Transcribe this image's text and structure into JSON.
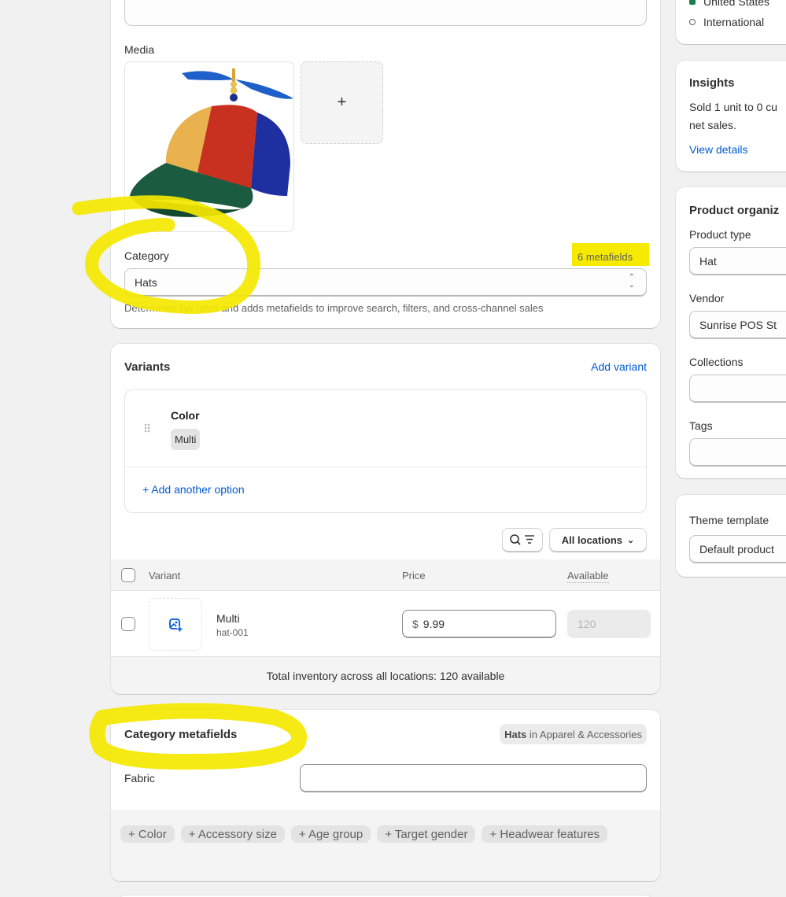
{
  "left_card": {
    "media_label": "Media",
    "add_media_symbol": "+",
    "category_label": "Category",
    "metafields_count": "6 metafields",
    "category_value": "Hats",
    "category_help": "Determines tax rates and adds metafields to improve search, filters, and cross-channel sales"
  },
  "variants": {
    "title": "Variants",
    "add_variant": "Add variant",
    "option_name": "Color",
    "option_values": [
      "Multi"
    ],
    "add_option": "+ Add another option",
    "locations_filter": "All locations",
    "table_headers": {
      "variant": "Variant",
      "price": "Price",
      "available": "Available"
    },
    "rows": [
      {
        "name": "Multi",
        "sku": "hat-001",
        "currency": "$",
        "price": "9.99",
        "available": "120"
      }
    ],
    "total_inventory": "Total inventory across all locations: 120 available"
  },
  "category_metafields": {
    "title": "Category metafields",
    "badge_bold": "Hats",
    "badge_rest": " in Apparel & Accessories",
    "fields": [
      {
        "label": "Fabric",
        "value": ""
      }
    ],
    "suggestions": [
      "+ Color",
      "+ Accessory size",
      "+ Age group",
      "+ Target gender",
      "+ Headwear features"
    ]
  },
  "sidebar": {
    "markets": [
      {
        "label": "United States",
        "status": "active"
      },
      {
        "label": "International",
        "status": "inactive"
      }
    ],
    "insights": {
      "title": "Insights",
      "text_line1": "Sold 1 unit to 0 cu",
      "text_line2": "net sales.",
      "link": "View details"
    },
    "organization": {
      "title": "Product organiz",
      "product_type_label": "Product type",
      "product_type_value": "Hat",
      "vendor_label": "Vendor",
      "vendor_value": "Sunrise POS St",
      "collections_label": "Collections",
      "collections_value": "",
      "tags_label": "Tags",
      "tags_value": ""
    },
    "theme": {
      "label": "Theme template",
      "value": "Default product"
    }
  },
  "colors": {
    "accent": "#005bd3",
    "highlight": "#f5ea00",
    "market_active": "#1a7f4b"
  }
}
